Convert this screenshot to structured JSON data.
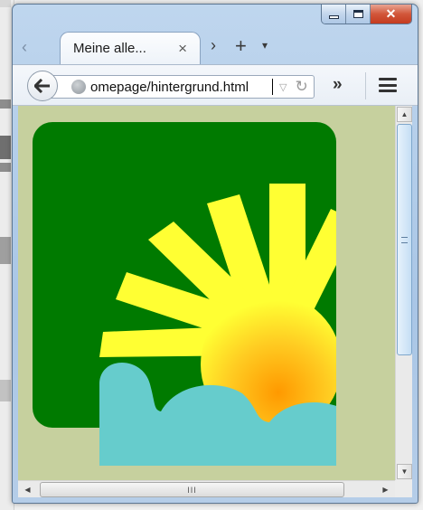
{
  "window": {
    "caption": {
      "minimize_glyph": "–",
      "maximize_glyph": "□",
      "close_glyph": "✕"
    }
  },
  "tabs": [
    {
      "label": "Meine alle...",
      "close_glyph": "×"
    }
  ],
  "tabbar": {
    "scroll_left_glyph": "‹",
    "scroll_right_glyph": "›",
    "new_tab_glyph": "+",
    "list_all_tabs_glyph": "▾"
  },
  "navbar": {
    "back_glyph": "🡐",
    "url": "omepage/hintergrund.html",
    "url_dropdown_glyph": "▽",
    "reload_glyph": "↻",
    "overflow_glyph": "»"
  },
  "scrollbars": {
    "up_glyph": "▲",
    "down_glyph": "▼",
    "left_glyph": "◀",
    "right_glyph": "▶",
    "horizontal_grip": "III"
  },
  "colors": {
    "page_background": "#c6d09e",
    "logo_green": "#007a00",
    "ray_yellow": "#ffff33",
    "sun_orange": "#ff9900",
    "cloud_teal": "#66cccc"
  },
  "icons": {
    "site_identity": "globe-icon",
    "menu": "hamburger-menu-icon"
  }
}
